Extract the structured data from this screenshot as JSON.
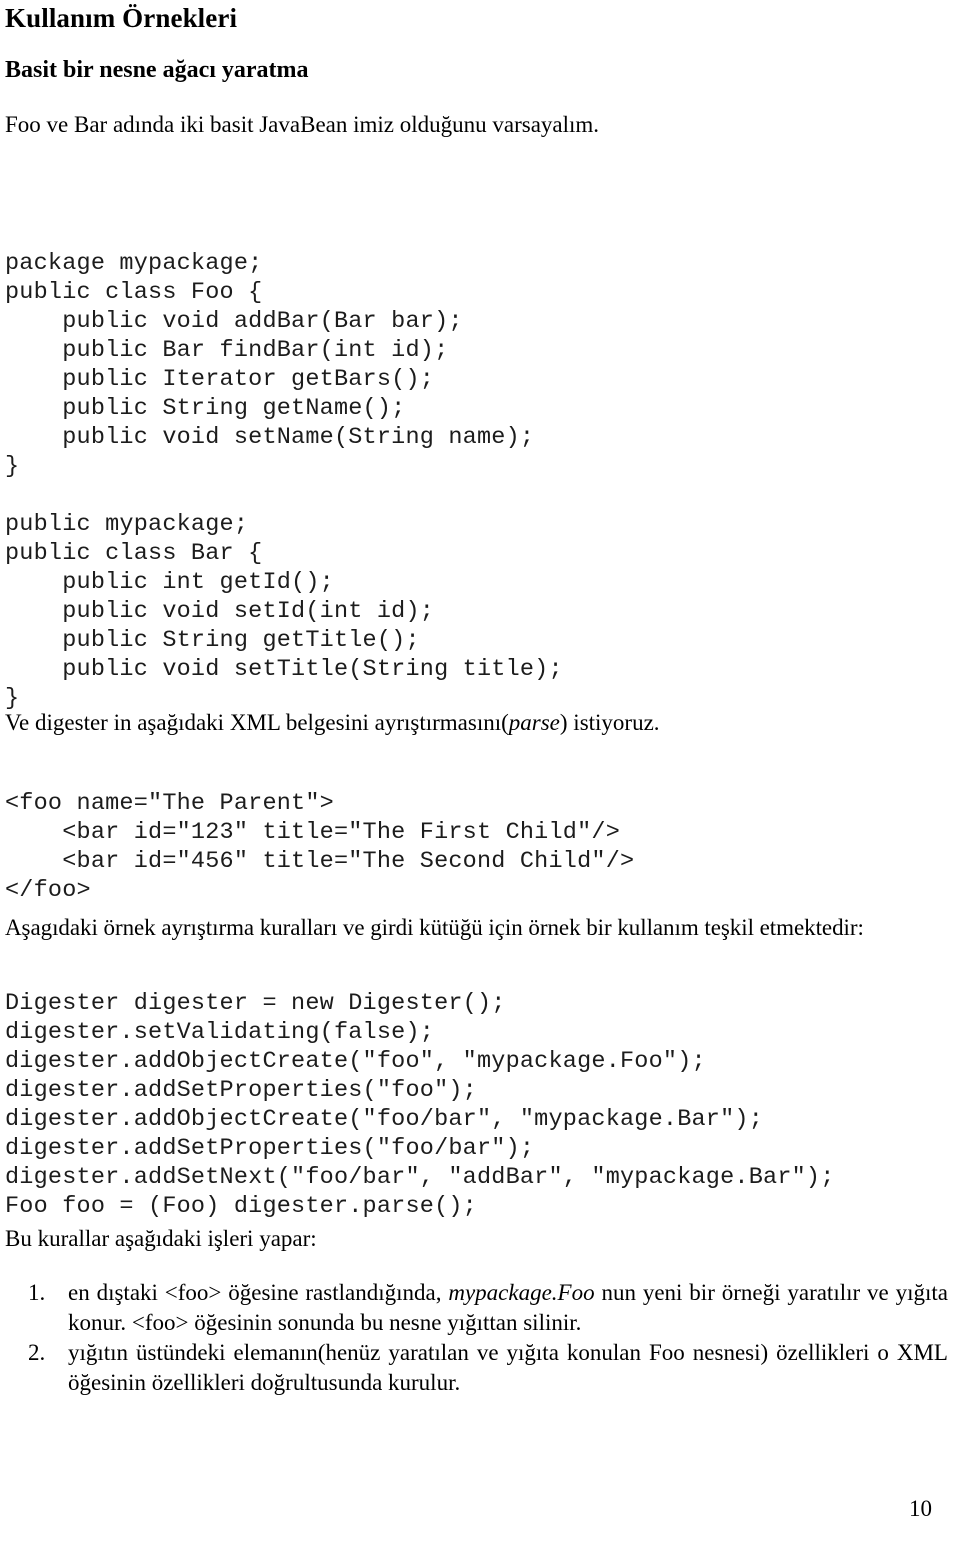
{
  "document": {
    "title": "Kullanım Örnekleri",
    "subtitle": "Basit bir nesne ağacı yaratma",
    "intro_paragraph": "Foo ve Bar adında iki basit JavaBean imiz olduğunu varsayalım.",
    "code_beans": "package mypackage;\npublic class Foo {\n    public void addBar(Bar bar);\n    public Bar findBar(int id);\n    public Iterator getBars();\n    public String getName();\n    public void setName(String name);\n}\n\npublic mypackage;\npublic class Bar {\n    public int getId();\n    public void setId(int id);\n    public String getTitle();\n    public void setTitle(String title);\n}",
    "xml_paragraph_before": "Ve digester in aşağıdaki XML belgesini ayrıştırmasını(",
    "xml_paragraph_italic": "parse",
    "xml_paragraph_after": ") istiyoruz.",
    "code_xml": "<foo name=\"The Parent\">\n    <bar id=\"123\" title=\"The First Child\"/>\n    <bar id=\"456\" title=\"The Second Child\"/>\n</foo>",
    "rules_paragraph": "Aşagıdaki örnek ayrıştırma kuralları ve girdi kütüğü için örnek bir kullanım teşkil etmektedir:",
    "code_digester": "Digester digester = new Digester();\ndigester.setValidating(false);\ndigester.addObjectCreate(\"foo\", \"mypackage.Foo\");\ndigester.addSetProperties(\"foo\");\ndigester.addObjectCreate(\"foo/bar\", \"mypackage.Bar\");\ndigester.addSetProperties(\"foo/bar\");\ndigester.addSetNext(\"foo/bar\", \"addBar\", \"mypackage.Bar\");\nFoo foo = (Foo) digester.parse();",
    "work_paragraph": "Bu kurallar aşağıdaki işleri yapar:",
    "rules_list": [
      {
        "marker": "1.",
        "before_italic": "en dıştaki <foo> öğesine rastlandığında, ",
        "italic": "mypackage.Foo",
        "after_italic": " nun yeni bir örneği yaratılır ve yığıta konur. <foo> öğesinin sonunda bu nesne yığıttan silinir."
      },
      {
        "marker": "2.",
        "before_italic": "yığıtın üstündeki elemanın(henüz yaratılan ve yığıta konulan Foo nesnesi)  özellikleri o XML öğesinin özellikleri doğrultusunda kurulur.",
        "italic": "",
        "after_italic": ""
      }
    ],
    "page_number": "10"
  }
}
